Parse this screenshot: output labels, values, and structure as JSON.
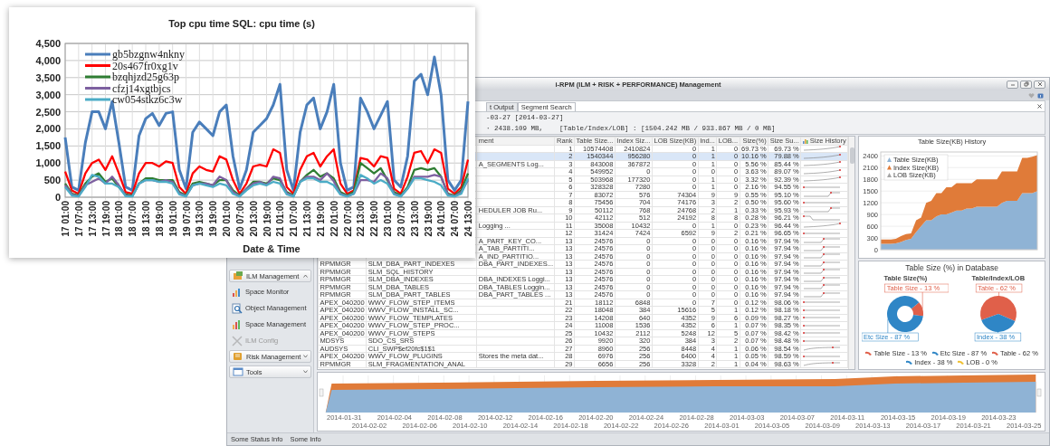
{
  "cpu_chart": {
    "chart_data": {
      "type": "line",
      "title": "Top cpu time SQL: cpu time (s)",
      "xlabel": "Date & Time",
      "categories": [
        "17 01:00",
        null,
        "17 07:00",
        null,
        "17 13:00",
        null,
        "17 19:00",
        null,
        "18 01:00",
        null,
        "18 07:00",
        null,
        "18 13:00",
        null,
        "18 19:00",
        null,
        "19 01:00",
        null,
        "19 07:00",
        null,
        "19 13:00",
        null,
        "19 19:00",
        null,
        "20 01:00",
        null,
        "20 07:00",
        null,
        "20 13:00",
        null,
        "20 19:00",
        null,
        "21 01:00",
        null,
        "21 07:00",
        null,
        "21 13:00",
        null,
        "21 19:00",
        null,
        "22 01:00",
        null,
        "22 07:00",
        null,
        "22 13:00",
        null,
        "22 19:00",
        null,
        "23 01:00",
        null,
        "23 07:00",
        null,
        "23 13:00",
        null,
        "23 19:00",
        null,
        "24 01:00",
        null,
        "24 07:00",
        null,
        "24 13:00"
      ],
      "grid": true,
      "legend": "upper left",
      "ylim": [
        0,
        4500
      ],
      "yticks": [
        {
          "value": 0,
          "label": "0"
        },
        {
          "value": 500,
          "label": "500"
        },
        {
          "value": 1000,
          "label": "1,000"
        },
        {
          "value": 1500,
          "label": "1,500"
        },
        {
          "value": 2000,
          "label": "2,000"
        },
        {
          "value": 2500,
          "label": "2,500"
        },
        {
          "value": 3000,
          "label": "3,000"
        },
        {
          "value": 3500,
          "label": "3,500"
        },
        {
          "value": 4000,
          "label": "4,000"
        },
        {
          "value": 4500,
          "label": "4,500"
        }
      ],
      "series": [
        {
          "name": "gb5bzgnw4nkny",
          "color": "#4a7ebb",
          "values": [
            1750,
            300,
            200,
            1600,
            2500,
            2500,
            2000,
            2800,
            1600,
            300,
            200,
            1800,
            2300,
            2450,
            2100,
            2450,
            2500,
            800,
            250,
            1900,
            2200,
            2000,
            1800,
            2500,
            2700,
            1200,
            250,
            800,
            1900,
            2100,
            2300,
            2700,
            3300,
            800,
            200,
            1900,
            2700,
            2900,
            2000,
            2500,
            3300,
            1000,
            200,
            300,
            2900,
            2500,
            2000,
            2400,
            2800,
            500,
            300,
            1200,
            3400,
            3600,
            3000,
            4100,
            3000,
            500,
            200,
            500,
            2800
          ]
        },
        {
          "name": "20s467fr0xg1v",
          "color": "#ff0000",
          "values": [
            750,
            200,
            100,
            700,
            1000,
            1100,
            800,
            1200,
            700,
            150,
            100,
            700,
            1000,
            1000,
            900,
            1050,
            1000,
            300,
            100,
            700,
            900,
            800,
            750,
            1200,
            1100,
            500,
            100,
            400,
            900,
            950,
            900,
            1400,
            1300,
            300,
            100,
            800,
            1200,
            1300,
            900,
            1200,
            1400,
            400,
            100,
            200,
            1150,
            1100,
            900,
            1200,
            1150,
            250,
            100,
            600,
            1300,
            1350,
            1000,
            1400,
            1300,
            250,
            100,
            300,
            1100
          ]
        },
        {
          "name": "bzqhjzd25g63p",
          "color": "#2e7d32",
          "values": [
            400,
            100,
            50,
            400,
            600,
            700,
            450,
            550,
            300,
            80,
            50,
            400,
            550,
            550,
            500,
            500,
            500,
            150,
            50,
            400,
            450,
            400,
            350,
            500,
            500,
            200,
            50,
            250,
            450,
            450,
            400,
            550,
            500,
            150,
            50,
            450,
            650,
            800,
            600,
            700,
            550,
            150,
            50,
            150,
            1000,
            850,
            700,
            850,
            500,
            150,
            50,
            300,
            800,
            850,
            800,
            850,
            600,
            100,
            50,
            200,
            700
          ]
        },
        {
          "name": "cfzj14xgtbjcs",
          "color": "#7d60a0",
          "values": [
            350,
            80,
            30,
            350,
            450,
            550,
            400,
            600,
            350,
            50,
            30,
            400,
            500,
            500,
            450,
            500,
            450,
            120,
            30,
            350,
            400,
            400,
            350,
            600,
            500,
            150,
            30,
            250,
            400,
            450,
            360,
            600,
            550,
            120,
            30,
            450,
            600,
            600,
            500,
            700,
            470,
            100,
            30,
            100,
            500,
            500,
            450,
            700,
            550,
            100,
            30,
            250,
            600,
            600,
            600,
            650,
            600,
            80,
            30,
            150,
            500
          ]
        },
        {
          "name": "cw054stkz6c3w",
          "color": "#4bacc6",
          "values": [
            300,
            50,
            20,
            300,
            650,
            600,
            400,
            400,
            300,
            30,
            20,
            400,
            500,
            500,
            450,
            450,
            400,
            80,
            20,
            350,
            400,
            350,
            300,
            400,
            350,
            100,
            20,
            200,
            350,
            400,
            350,
            450,
            400,
            80,
            20,
            450,
            550,
            550,
            450,
            450,
            350,
            80,
            20,
            100,
            650,
            550,
            400,
            500,
            400,
            80,
            20,
            250,
            550,
            550,
            500,
            450,
            350,
            50,
            20,
            100,
            550
          ]
        }
      ]
    }
  },
  "window": {
    "title": "i-RPM (ILM + RISK + PERFORMANCE) Management"
  },
  "sidebar": {
    "groups": [
      {
        "label": "ILM Management",
        "expanded": true,
        "items": [
          {
            "label": "Space Monitor",
            "disabled": false
          },
          {
            "label": "Object Management",
            "disabled": false
          },
          {
            "label": "Space Management",
            "disabled": false
          },
          {
            "label": "ILM Config",
            "disabled": true
          }
        ]
      },
      {
        "label": "Risk Management",
        "expanded": false
      },
      {
        "label": "Tools",
        "expanded": false
      }
    ]
  },
  "tabs": [
    {
      "label": "t Output",
      "selected": false
    },
    {
      "label": "Segment Search",
      "selected": true
    }
  ],
  "summary": {
    "lines": [
      "-03-27 [2014-03-27]",
      "· 2438.109 MB,    [Table/Index/LOB] : [1504.242 MB / 933.867 MB / 0 MB]"
    ]
  },
  "table": {
    "columns": [
      "ment",
      "Rank",
      "Table Size...",
      "Index Siz...",
      "LOB Size(KB)",
      "Ind...",
      "LOB...",
      "Size(%)",
      "Size Su...",
      "Size History"
    ],
    "rows": [
      {
        "rank": "1",
        "table_size": "10574408",
        "index_size": "2410824",
        "lob_size": "0",
        "ind": "1",
        "lob": "0",
        "size_pct": "69.73 %",
        "size_sum": "69.73 %",
        "selected": false
      },
      {
        "rank": "2",
        "table_size": "1540344",
        "index_size": "956280",
        "lob_size": "0",
        "ind": "1",
        "lob": "0",
        "size_pct": "10.16 %",
        "size_sum": "79.88 %",
        "selected": true
      },
      {
        "comment": "A_SEGMENTS Log...",
        "rank": "3",
        "table_size": "843008",
        "index_size": "367872",
        "lob_size": "0",
        "ind": "1",
        "lob": "0",
        "size_pct": "5.56 %",
        "size_sum": "85.44 %",
        "selected": false
      },
      {
        "rank": "4",
        "table_size": "549952",
        "index_size": "0",
        "lob_size": "0",
        "ind": "0",
        "lob": "0",
        "size_pct": "3.63 %",
        "size_sum": "89.07 %",
        "selected": false
      },
      {
        "rank": "5",
        "table_size": "503968",
        "index_size": "177320",
        "lob_size": "0",
        "ind": "1",
        "lob": "0",
        "size_pct": "3.32 %",
        "size_sum": "92.39 %",
        "selected": false
      },
      {
        "rank": "6",
        "table_size": "328328",
        "index_size": "7280",
        "lob_size": "0",
        "ind": "1",
        "lob": "0",
        "size_pct": "2.16 %",
        "size_sum": "94.55 %",
        "selected": false
      },
      {
        "rank": "7",
        "table_size": "83072",
        "index_size": "576",
        "lob_size": "74304",
        "ind": "9",
        "lob": "9",
        "size_pct": "0.55 %",
        "size_sum": "95.10 %",
        "selected": false
      },
      {
        "rank": "8",
        "table_size": "75456",
        "index_size": "704",
        "lob_size": "74176",
        "ind": "3",
        "lob": "2",
        "size_pct": "0.50 %",
        "size_sum": "95.60 %",
        "selected": false
      },
      {
        "comment": "HEDULER JOB Ru...",
        "rank": "9",
        "table_size": "50112",
        "index_size": "768",
        "lob_size": "24768",
        "ind": "2",
        "lob": "1",
        "size_pct": "0.33 %",
        "size_sum": "95.93 %",
        "selected": false
      },
      {
        "rank": "10",
        "table_size": "42112",
        "index_size": "512",
        "lob_size": "24192",
        "ind": "8",
        "lob": "8",
        "size_pct": "0.28 %",
        "size_sum": "96.21 %",
        "selected": false
      },
      {
        "comment": "Logging ...",
        "rank": "11",
        "table_size": "35008",
        "index_size": "10432",
        "lob_size": "0",
        "ind": "1",
        "lob": "0",
        "size_pct": "0.23 %",
        "size_sum": "96.44 %",
        "selected": false
      },
      {
        "rank": "12",
        "table_size": "31424",
        "index_size": "7424",
        "lob_size": "6592",
        "ind": "9",
        "lob": "2",
        "size_pct": "0.21 %",
        "size_sum": "96.65 %",
        "selected": false
      },
      {
        "comment": "A_PART_KEY_CO...",
        "rank": "13",
        "table_size": "24576",
        "index_size": "0",
        "lob_size": "0",
        "ind": "0",
        "lob": "0",
        "size_pct": "0.16 %",
        "size_sum": "97.94 %",
        "selected": false
      },
      {
        "comment": "A_TAB_PARTITI...",
        "rank": "13",
        "table_size": "24576",
        "index_size": "0",
        "lob_size": "0",
        "ind": "0",
        "lob": "0",
        "size_pct": "0.16 %",
        "size_sum": "97.94 %",
        "selected": false
      },
      {
        "comment": "A_IND_PARTITIO...",
        "rank": "13",
        "table_size": "24576",
        "index_size": "0",
        "lob_size": "0",
        "ind": "0",
        "lob": "0",
        "size_pct": "0.16 %",
        "size_sum": "97.94 %",
        "selected": false
      },
      {
        "owner": "RPMMGR",
        "name": "SLM_DBA_PART_INDEXES",
        "comment": "DBA_PART_INDEXES...",
        "rank": "13",
        "table_size": "24576",
        "index_size": "0",
        "lob_size": "0",
        "ind": "0",
        "lob": "0",
        "size_pct": "0.16 %",
        "size_sum": "97.94 %",
        "selected": false
      },
      {
        "owner": "RPMMGR",
        "name": "SLM_SQL_HISTORY",
        "rank": "13",
        "table_size": "24576",
        "index_size": "0",
        "lob_size": "0",
        "ind": "0",
        "lob": "0",
        "size_pct": "0.16 %",
        "size_sum": "97.94 %",
        "selected": false
      },
      {
        "owner": "RPMMGR",
        "name": "SLM_DBA_INDEXES",
        "comment": "DBA_INDEXES Loggi...",
        "rank": "13",
        "table_size": "24576",
        "index_size": "0",
        "lob_size": "0",
        "ind": "0",
        "lob": "0",
        "size_pct": "0.16 %",
        "size_sum": "97.94 %",
        "selected": false
      },
      {
        "owner": "RPMMGR",
        "name": "SLM_DBA_TABLES",
        "comment": "DBA_TABLES Loggin...",
        "rank": "13",
        "table_size": "24576",
        "index_size": "0",
        "lob_size": "0",
        "ind": "0",
        "lob": "0",
        "size_pct": "0.16 %",
        "size_sum": "97.94 %",
        "selected": false
      },
      {
        "owner": "RPMMGR",
        "name": "SLM_DBA_PART_TABLES",
        "comment": "DBA_PART_TABLES ...",
        "rank": "13",
        "table_size": "24576",
        "index_size": "0",
        "lob_size": "0",
        "ind": "0",
        "lob": "0",
        "size_pct": "0.16 %",
        "size_sum": "97.94 %",
        "selected": false
      },
      {
        "owner": "APEX_040200",
        "name": "WWV_FLOW_STEP_ITEMS",
        "rank": "21",
        "table_size": "18112",
        "index_size": "6848",
        "lob_size": "0",
        "ind": "7",
        "lob": "0",
        "size_pct": "0.12 %",
        "size_sum": "98.06 %",
        "selected": false
      },
      {
        "owner": "APEX_040200",
        "name": "WWV_FLOW_INSTALL_SC...",
        "rank": "22",
        "table_size": "18048",
        "index_size": "384",
        "lob_size": "15616",
        "ind": "5",
        "lob": "1",
        "size_pct": "0.12 %",
        "size_sum": "98.18 %",
        "selected": false
      },
      {
        "owner": "APEX_040200",
        "name": "WWV_FLOW_TEMPLATES",
        "rank": "23",
        "table_size": "14208",
        "index_size": "640",
        "lob_size": "4352",
        "ind": "9",
        "lob": "6",
        "size_pct": "0.09 %",
        "size_sum": "98.27 %",
        "selected": false
      },
      {
        "owner": "APEX_040200",
        "name": "WWV_FLOW_STEP_PROC...",
        "rank": "24",
        "table_size": "11008",
        "index_size": "1536",
        "lob_size": "4352",
        "ind": "6",
        "lob": "1",
        "size_pct": "0.07 %",
        "size_sum": "98.35 %",
        "selected": false
      },
      {
        "owner": "APEX_040200",
        "name": "WWV_FLOW_STEPS",
        "rank": "25",
        "table_size": "10432",
        "index_size": "2112",
        "lob_size": "5248",
        "ind": "12",
        "lob": "5",
        "size_pct": "0.07 %",
        "size_sum": "98.42 %",
        "selected": false
      },
      {
        "owner": "MDSYS",
        "name": "SDO_CS_SRS",
        "rank": "26",
        "table_size": "9920",
        "index_size": "320",
        "lob_size": "384",
        "ind": "3",
        "lob": "2",
        "size_pct": "0.07 %",
        "size_sum": "98.48 %",
        "selected": false
      },
      {
        "owner": "AUDSYS",
        "name": "CLI_SWP$ef20fc$1$1",
        "rank": "27",
        "table_size": "8960",
        "index_size": "256",
        "lob_size": "8448",
        "ind": "4",
        "lob": "1",
        "size_pct": "0.06 %",
        "size_sum": "98.54 %",
        "selected": false
      },
      {
        "owner": "APEX_040200",
        "name": "WWV_FLOW_PLUGINS",
        "comment": "Stores the meta dat...",
        "rank": "28",
        "table_size": "6976",
        "index_size": "256",
        "lob_size": "6400",
        "ind": "4",
        "lob": "1",
        "size_pct": "0.05 %",
        "size_sum": "98.59 %",
        "selected": false
      },
      {
        "owner": "RPMMGR",
        "name": "SLM_FRAGMENTATION_ANAL",
        "rank": "29",
        "table_size": "6656",
        "index_size": "256",
        "lob_size": "3328",
        "ind": "2",
        "lob": "1",
        "size_pct": "0.04 %",
        "size_sum": "98.63 %",
        "selected": false
      }
    ]
  },
  "size_history": {
    "chart_data": {
      "type": "area",
      "title": "Table Size(KB) History",
      "stacked": true,
      "grid": true,
      "legend": "upper left",
      "ylim": [
        0,
        2500
      ],
      "yticks": [
        0,
        300,
        600,
        900,
        1200,
        1500,
        1800,
        2100,
        2400
      ],
      "series": [
        {
          "name": "Table Size(KB)",
          "color": "#8fb3d5",
          "values": [
            150,
            150,
            150,
            160,
            200,
            250,
            280,
            450,
            600,
            750,
            750,
            850,
            900,
            900,
            950,
            1000,
            1000,
            1050,
            1050,
            1100,
            1100,
            1100,
            1100,
            1100,
            1200,
            1250,
            1250,
            1250,
            1450,
            1450,
            1450,
            1500
          ]
        },
        {
          "name": "Index Size(KB)",
          "color": "#e07b39",
          "values": [
            110,
            110,
            110,
            120,
            150,
            150,
            140,
            300,
            220,
            450,
            500,
            600,
            550,
            700,
            650,
            700,
            700,
            650,
            650,
            700,
            700,
            700,
            700,
            700,
            800,
            750,
            750,
            750,
            900,
            900,
            930,
            920
          ]
        },
        {
          "name": "LOB Size(KB)",
          "color": "#a5a5a5",
          "values": [
            null,
            null,
            null,
            null,
            null,
            null,
            null,
            null,
            null,
            null,
            null,
            null,
            null,
            null,
            null,
            null,
            null,
            null,
            null,
            null,
            null,
            null,
            null,
            null,
            null,
            null,
            null,
            null,
            null,
            null,
            null,
            null
          ]
        }
      ]
    }
  },
  "size_share": {
    "title": "Table Size (%) in Database",
    "charts": [
      {
        "chart_data": {
          "type": "donut",
          "title": "Table Size(%)",
          "categories": [
            "Table Size - 13 %",
            "Etc Size - 87 %"
          ],
          "values": [
            13,
            87
          ],
          "colors": [
            "#e0604a",
            "#2f86c6"
          ]
        }
      },
      {
        "chart_data": {
          "type": "pie",
          "title": "Table/Index/LOB",
          "categories": [
            "Table - 62 %",
            "Index - 38 %"
          ],
          "values": [
            62,
            38
          ],
          "colors": [
            "#e0604a",
            "#2f86c6"
          ]
        }
      }
    ],
    "legend": [
      {
        "label": "Table Size - 13 %",
        "color": "#e0604a"
      },
      {
        "label": "Etc Size - 87 %",
        "color": "#2f86c6"
      },
      {
        "label": "Table - 62 %",
        "color": "#e0604a"
      },
      {
        "label": "Index - 38 %",
        "color": "#2f86c6"
      },
      {
        "label": "LOB - 0 %",
        "color": "#f0c030"
      }
    ]
  },
  "overview": {
    "x_labels": [
      "2014-01-31",
      "2014-02-02",
      "2014-02-04",
      "2014-02-06",
      "2014-02-08",
      "2014-02-10",
      "2014-02-12",
      "2014-02-14",
      "2014-02-16",
      "2014-02-18",
      "2014-02-20",
      "2014-02-22",
      "2014-02-24",
      "2014-02-26",
      "2014-02-28",
      "2014-03-01",
      "2014-03-03",
      "2014-03-05",
      "2014-03-07",
      "2014-03-09",
      "2014-03-11",
      "2014-03-13",
      "2014-03-15",
      "2014-03-17",
      "2014-03-19",
      "2014-03-21",
      "2014-03-23",
      "2014-03-25"
    ]
  },
  "status_bar": [
    "Some Status Info",
    "Some Info"
  ]
}
